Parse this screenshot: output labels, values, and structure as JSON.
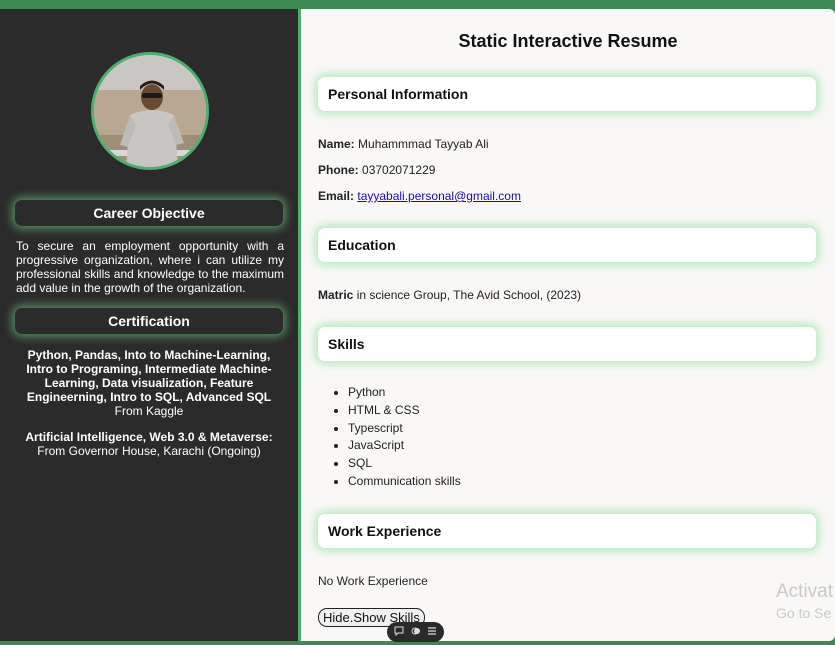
{
  "page_title": "Static Interactive Resume",
  "sidebar": {
    "career_heading": "Career Objective",
    "career_text": "To secure an employment opportunity with a progressive organization, where i can utilize my professional skills and knowledge to the maximum add value in the growth of the organization.",
    "cert_heading": "Certification",
    "cert1_bold": "Python, Pandas, Into to Machine-Learning, Intro to Programing, Intermediate Machine-Learning, Data visualization, Feature Engineerning, Intro to SQL, Advanced SQL",
    "cert1_source": "From Kaggle",
    "cert2_bold": "Artificial Intelligence, Web 3.0 & Metaverse:",
    "cert2_source": "From Governor House, Karachi (Ongoing)"
  },
  "personal": {
    "heading": "Personal Information",
    "name_label": "Name:",
    "name_value": "Muhammmad Tayyab Ali",
    "phone_label": "Phone:",
    "phone_value": "03702071229",
    "email_label": "Email:",
    "email_value": "tayyabali.personal@gmail.com"
  },
  "education": {
    "heading": "Education",
    "degree": "Matric",
    "details": "in science Group, The Avid School, (2023)"
  },
  "skills": {
    "heading": "Skills",
    "items": [
      "Python",
      "HTML & CSS",
      "Typescript",
      "JavaScript",
      "SQL",
      "Communication skills"
    ]
  },
  "work": {
    "heading": "Work Experience",
    "text": "No Work Experience"
  },
  "toggle_button": "Hide.Show Skills",
  "watermark": {
    "line1": "Activat",
    "line2": "Go to Se"
  },
  "colors": {
    "accent": "#4caf6e",
    "sidebar_bg": "#2b2b2b",
    "main_bg": "#f9f8f6",
    "outer_bg": "#3d8a55"
  }
}
